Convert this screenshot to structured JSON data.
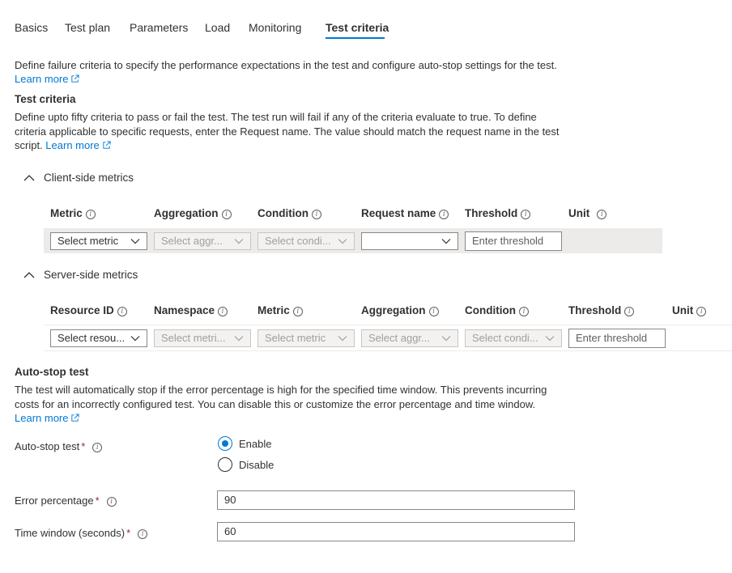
{
  "tabs": [
    {
      "label": "Basics"
    },
    {
      "label": "Test plan"
    },
    {
      "label": "Parameters"
    },
    {
      "label": "Load"
    },
    {
      "label": "Monitoring"
    },
    {
      "label": "Test criteria",
      "active": true
    }
  ],
  "intro": {
    "text": "Define failure criteria to specify the performance expectations in the test and configure auto-stop settings for the test.",
    "learn_more": "Learn more"
  },
  "test_criteria": {
    "heading": "Test criteria",
    "line1": "Define upto fifty criteria to pass or fail the test. The test run will fail if any of the criteria evaluate to true. To define",
    "line2": "criteria applicable to specific requests, enter the Request name. The value should match the request name in the test",
    "line3": "script.",
    "learn_more": "Learn more"
  },
  "client_side": {
    "label": "Client-side metrics",
    "columns": [
      "Metric",
      "Aggregation",
      "Condition",
      "Request name",
      "Threshold",
      "Unit"
    ],
    "row": {
      "metric": "Select metric",
      "aggregation": "Select aggr...",
      "condition": "Select condi...",
      "request_name": "",
      "threshold_placeholder": "Enter threshold"
    }
  },
  "server_side": {
    "label": "Server-side metrics",
    "columns": [
      "Resource ID",
      "Namespace",
      "Metric",
      "Aggregation",
      "Condition",
      "Threshold",
      "Unit"
    ],
    "row": {
      "resource_id": "Select resou...",
      "namespace": "Select metri...",
      "metric": "Select metric",
      "aggregation": "Select aggr...",
      "condition": "Select condi...",
      "threshold_placeholder": "Enter threshold"
    }
  },
  "auto_stop": {
    "heading": "Auto-stop test",
    "line1": "The test will automatically stop if the error percentage is high for the specified time window. This prevents incurring",
    "line2": "costs for an incorrectly configured test. You can disable this or customize the error percentage and time window.",
    "learn_more": "Learn more",
    "toggle_label": "Auto-stop test",
    "enable_label": "Enable",
    "disable_label": "Disable",
    "selected": "Enable",
    "error_pct_label": "Error percentage",
    "error_pct_value": "90",
    "time_window_label": "Time window (seconds)",
    "time_window_value": "60",
    "required_mark": "*"
  },
  "colors": {
    "accent": "#0078d4",
    "required": "#a4262c",
    "row_background": "#edebe9",
    "disabled_field": "#f3f2f1"
  },
  "icons": {
    "external_link": "external-link-icon",
    "info": "info-icon",
    "chevron_up": "chevron-up-icon",
    "chevron_down": "chevron-down-icon"
  }
}
